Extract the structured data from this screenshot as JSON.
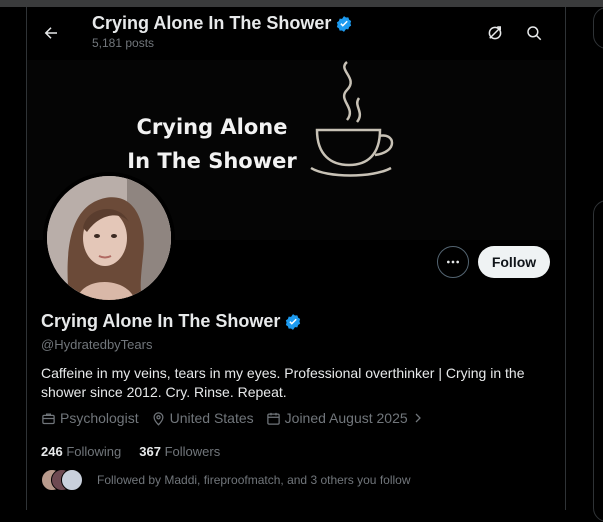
{
  "header": {
    "title": "Crying Alone In The Shower",
    "posts_count": "5,181 posts"
  },
  "banner": {
    "line1": "Crying Alone",
    "line2": "In The Shower"
  },
  "profile": {
    "display_name": "Crying Alone In The Shower",
    "handle": "@HydratedbyTears",
    "bio": "Caffeine in my veins, tears in my eyes. Professional overthinker | Crying in the shower since 2012. Cry. Rinse. Repeat.",
    "category": "Psychologist",
    "location": "United States",
    "joined": "Joined August 2025",
    "following_count": "246",
    "following_label": "Following",
    "followers_count": "367",
    "followers_label": "Followers",
    "followed_by": "Followed by Maddi, fireproofmatch, and 3 others you follow"
  },
  "buttons": {
    "follow_label": "Follow"
  },
  "colors": {
    "verified": "#1d9bf0",
    "follow_bg": "#eff3f4",
    "muted": "#71767b",
    "text": "#e7e9ea"
  },
  "icons": [
    "back-arrow-icon",
    "verified-badge-icon",
    "grok-icon",
    "search-icon",
    "more-icon",
    "briefcase-icon",
    "location-pin-icon",
    "calendar-icon",
    "chevron-right-icon",
    "coffee-cup-icon"
  ]
}
